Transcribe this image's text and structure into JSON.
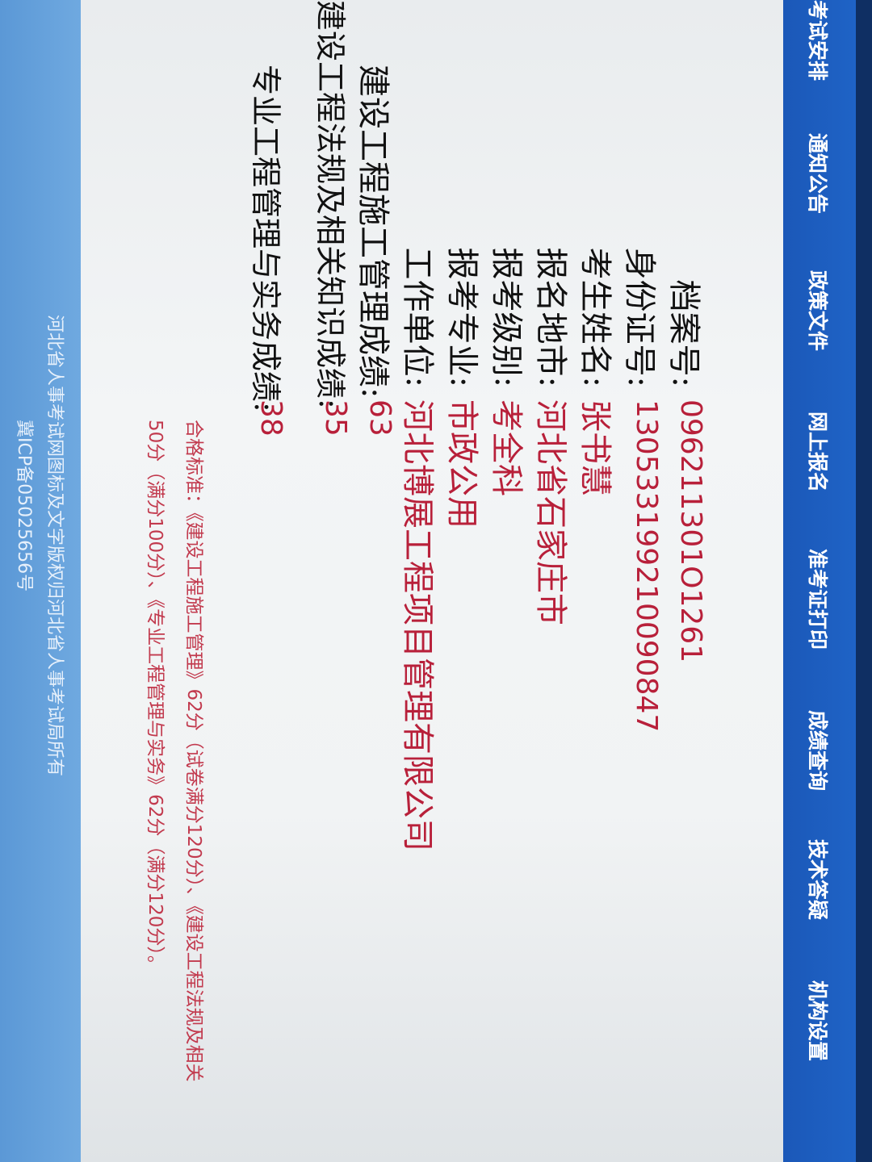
{
  "nav": {
    "items": [
      "考试安排",
      "通知公告",
      "政策文件",
      "网上报名",
      "准考证打印",
      "成绩查询",
      "技术答疑",
      "机构设置"
    ]
  },
  "info": {
    "file_no_label": "档案号:",
    "file_no": "096211301O1261",
    "id_label": "身份证号:",
    "id": "130533199210090847",
    "name_label": "考生姓名:",
    "name": "张书慧",
    "city_label": "报名地市:",
    "city": "河北省石家庄市",
    "level_label": "报考级别:",
    "level": "考全科",
    "major_label": "报考专业:",
    "major": "市政公用",
    "employer_label": "工作单位:",
    "employer": "河北博展工程项目管理有限公司",
    "score1_label": "建设工程施工管理成绩:",
    "score1": "63",
    "score2_label": "建设工程法规及相关知识成绩:",
    "score2": "35",
    "score3_label": "专业工程管理与实务成绩:",
    "score3": "38"
  },
  "standard": {
    "line1": "合格标准：《建设工程施工管理》62分（试卷满分120分）、《建设工程法规及相关",
    "line2": "50分（满分100分）、《专业工程管理与实务》62分（满分120分）。"
  },
  "footer": {
    "line1": "河北省人事考试网图标及文字版权归河北省人事考试局所有",
    "line2": "冀ICP备05025656号"
  },
  "colors": {
    "nav_bg": "#1f63c6",
    "value_text": "#b8203a",
    "standard_text": "#c23a4e",
    "footer_bg": "#6fa9e0"
  }
}
